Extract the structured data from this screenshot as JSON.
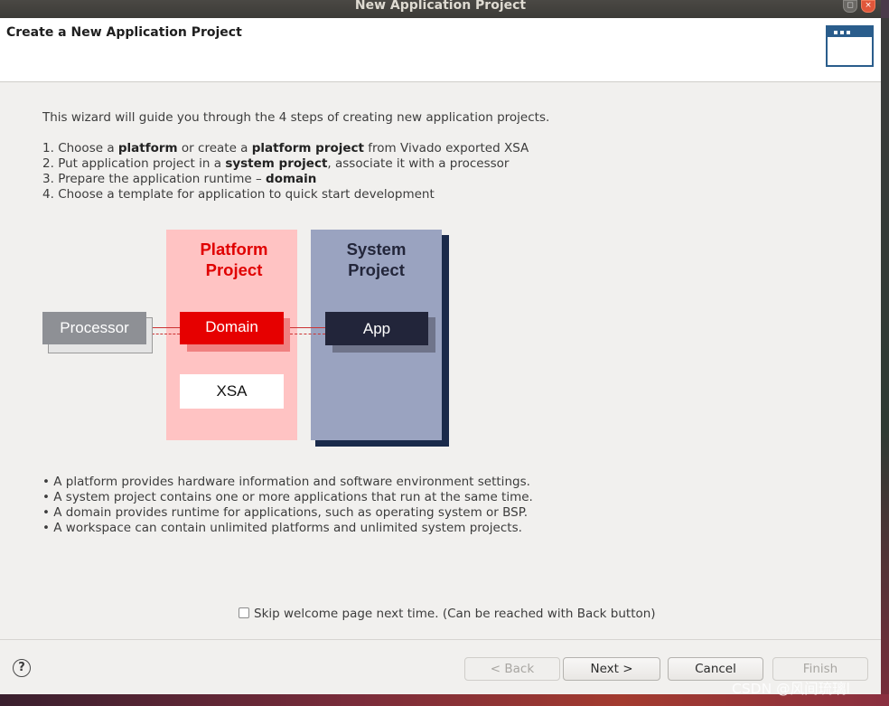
{
  "window": {
    "title": "New Application Project",
    "maximize_glyph": "◻",
    "close_glyph": "×"
  },
  "header": {
    "title": "Create a New Application Project",
    "icon": "window-icon"
  },
  "intro": "This wizard will guide you through the 4 steps of creating new application projects.",
  "steps": [
    {
      "num": "1.",
      "pre": "Choose a ",
      "b1": "platform",
      "mid": " or create a ",
      "b2": "platform project",
      "post": " from Vivado exported XSA"
    },
    {
      "num": "2.",
      "pre": "Put application project in a ",
      "b1": "system project",
      "post": ", associate it with a processor"
    },
    {
      "num": "3.",
      "pre": "Prepare the application runtime – ",
      "b1": "domain"
    },
    {
      "num": "4.",
      "pre": "Choose a template for application to quick start development"
    }
  ],
  "diagram": {
    "platform_title_1": "Platform",
    "platform_title_2": "Project",
    "system_title_1": "System",
    "system_title_2": "Project",
    "processor": "Processor",
    "domain": "Domain",
    "xsa": "XSA",
    "app": "App"
  },
  "bullets": [
    "• A platform provides hardware information and software environment settings.",
    "• A system project contains one or more applications that run at the same time.",
    "• A domain provides runtime for applications, such as operating system or BSP.",
    "• A workspace can contain unlimited platforms and unlimited system projects."
  ],
  "skip_checkbox": {
    "label": "Skip welcome page next time. (Can be reached with Back button)",
    "checked": false
  },
  "buttons": {
    "help": "?",
    "back": "< Back",
    "next": "Next >",
    "cancel": "Cancel",
    "finish": "Finish"
  },
  "watermark": "CSDN @风间琉璃ا"
}
